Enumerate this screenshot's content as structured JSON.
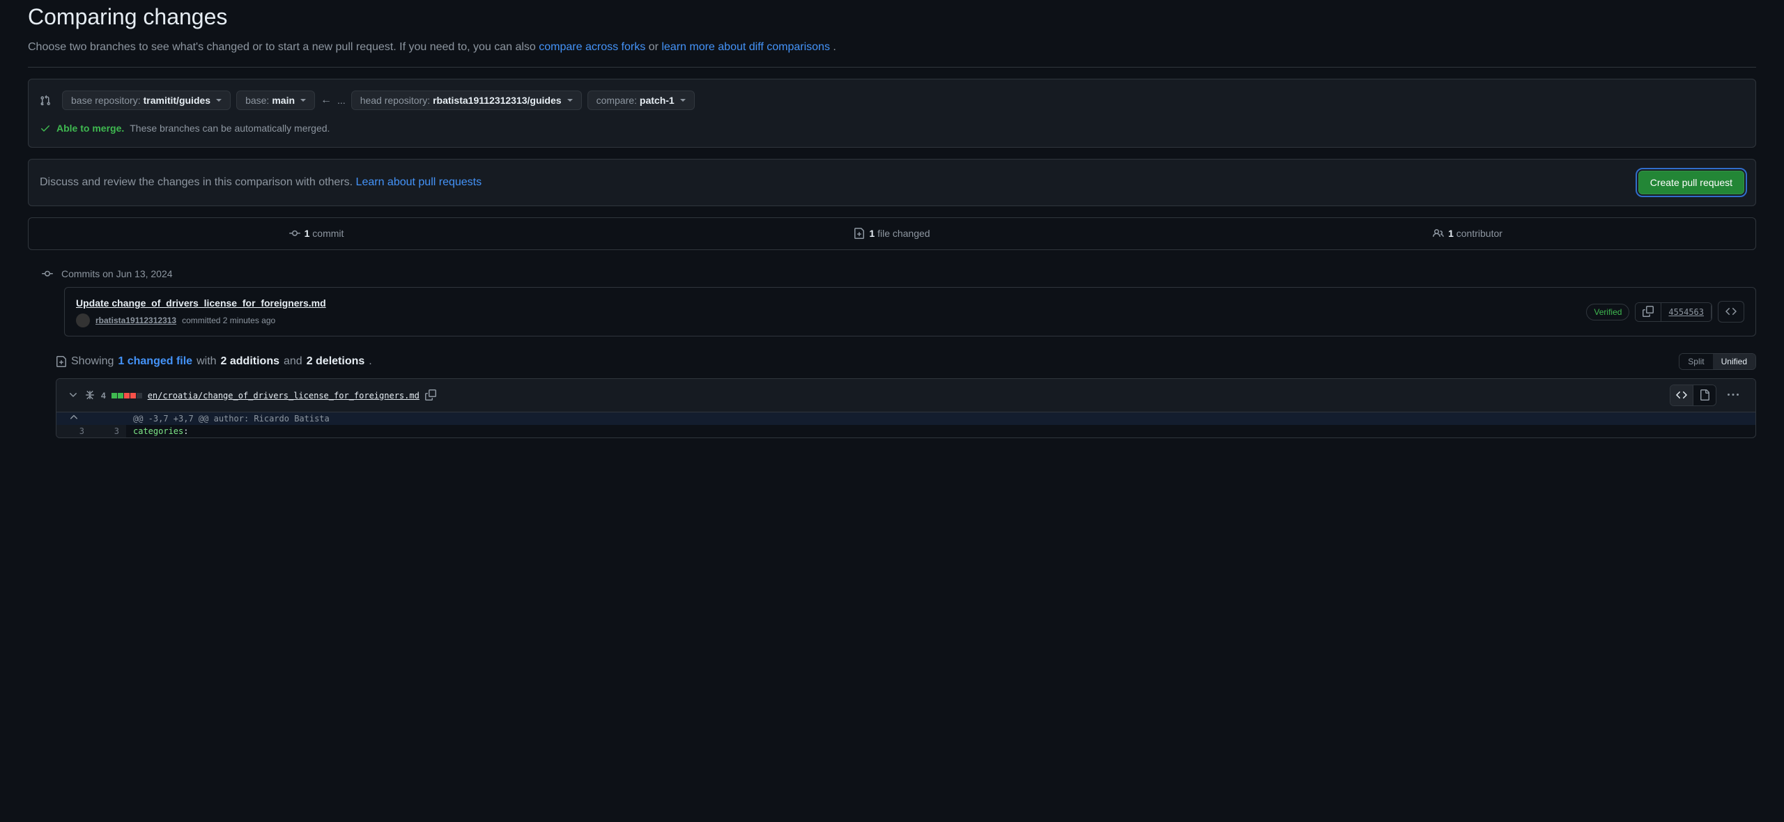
{
  "page": {
    "title": "Comparing changes",
    "subtitle_prefix": "Choose two branches to see what's changed or to start a new pull request. If you need to, you can also ",
    "compare_forks_link": "compare across forks",
    "subtitle_or": " or ",
    "learn_more_link": "learn more about diff comparisons",
    "subtitle_suffix": "."
  },
  "selectors": {
    "base_repo_label": "base repository: ",
    "base_repo_value": "tramitit/guides",
    "base_label": "base: ",
    "base_value": "main",
    "head_repo_label": "head repository: ",
    "head_repo_value": "rbatista19112312313/guides",
    "compare_label": "compare: ",
    "compare_value": "patch-1",
    "arrow": "←",
    "ellipsis": "..."
  },
  "merge": {
    "able_text": "Able to merge.",
    "desc_text": " These branches can be automatically merged."
  },
  "discuss": {
    "text": "Discuss and review the changes in this comparison with others. ",
    "link": "Learn about pull requests",
    "button": "Create pull request"
  },
  "stats": {
    "commits_count": "1",
    "commits_label": " commit",
    "files_count": "1",
    "files_label": " file changed",
    "contributors_count": "1",
    "contributors_label": " contributor"
  },
  "commits": {
    "header": "Commits on Jun 13, 2024",
    "items": [
      {
        "title": "Update change_of_drivers_license_for_foreigners.md",
        "author": "rbatista19112312313",
        "committed_text": " committed 2 minutes ago",
        "verified": "Verified",
        "hash": "4554563"
      }
    ]
  },
  "summary": {
    "showing_prefix": "Showing ",
    "changed_file_link": "1 changed file",
    "with_text": " with ",
    "additions_count": "2 additions",
    "and_text": " and ",
    "deletions_count": "2 deletions",
    "period": "."
  },
  "view_toggle": {
    "split": "Split",
    "unified": "Unified"
  },
  "file": {
    "change_count": "4",
    "path": "en/croatia/change_of_drivers_license_for_foreigners.md",
    "hunk_header": "@@ -3,7 +3,7 @@ author: Ricardo Batista",
    "line_num_old": "3",
    "line_num_new": "3",
    "line_content": "categories",
    "line_colon": ":"
  }
}
